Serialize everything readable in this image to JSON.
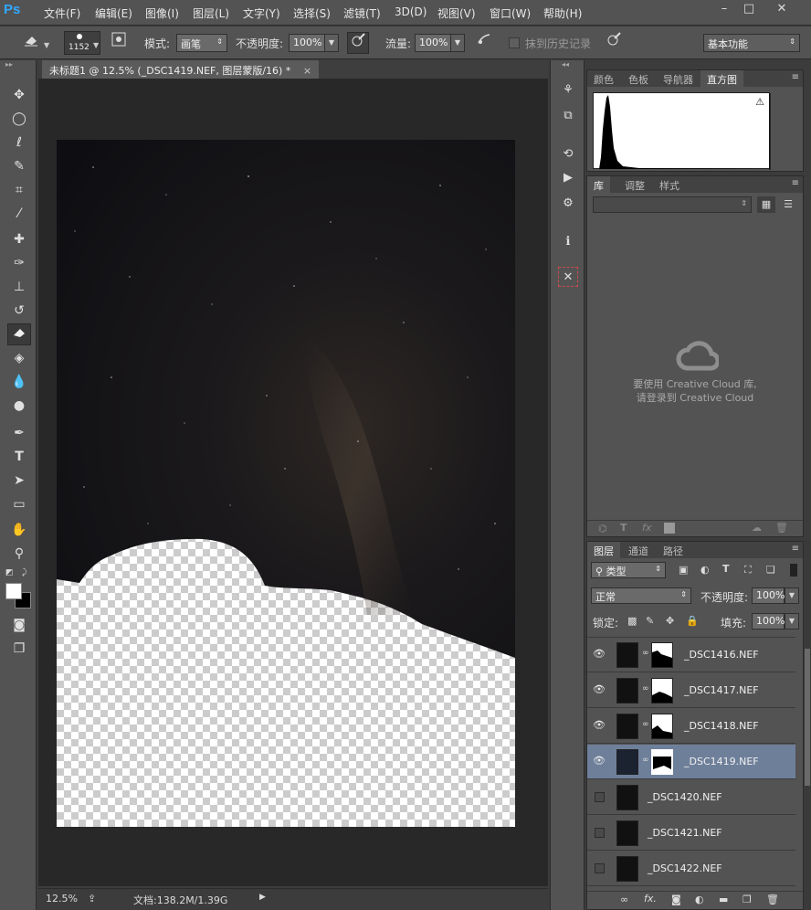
{
  "app": {
    "logo": "Ps"
  },
  "menu": [
    "文件(F)",
    "编辑(E)",
    "图像(I)",
    "图层(L)",
    "文字(Y)",
    "选择(S)",
    "滤镜(T)",
    "3D(D)",
    "视图(V)",
    "窗口(W)",
    "帮助(H)"
  ],
  "window_controls": {
    "minimize": "–",
    "maximize": "□",
    "close": "✕"
  },
  "options_bar": {
    "brush_size": "1152",
    "mode_label": "模式:",
    "mode_value": "画笔",
    "opacity_label": "不透明度:",
    "opacity_value": "100%",
    "flow_label": "流量:",
    "flow_value": "100%",
    "history_label": "抹到历史记录",
    "workspace": "基本功能"
  },
  "document": {
    "tab_title": "未标题1 @ 12.5% (_DSC1419.NEF, 图层蒙版/16) *",
    "tab_close": "×"
  },
  "status": {
    "zoom": "12.5%",
    "doc_info": "文档:138.2M/1.39G"
  },
  "panels": {
    "top_tabs": [
      "颜色",
      "色板",
      "导航器",
      "直方图"
    ],
    "top_active": 3,
    "mid_tabs": [
      "库",
      "调整",
      "样式"
    ],
    "mid_active": 0,
    "cc_message": [
      "要使用 Creative Cloud 库,",
      "请登录到 Creative Cloud"
    ],
    "layers_tabs": [
      "图层",
      "通道",
      "路径"
    ],
    "layers_active": 0
  },
  "layers": {
    "filter_type": "类型",
    "blend_mode": "正常",
    "opacity_label": "不透明度:",
    "opacity_value": "100%",
    "lock_label": "锁定:",
    "fill_label": "填充:",
    "fill_value": "100%",
    "items": [
      {
        "name": "_DSC1416.NEF",
        "visible": true,
        "has_mask": true,
        "selected": false
      },
      {
        "name": "_DSC1417.NEF",
        "visible": true,
        "has_mask": true,
        "selected": false
      },
      {
        "name": "_DSC1418.NEF",
        "visible": true,
        "has_mask": true,
        "selected": false
      },
      {
        "name": "_DSC1419.NEF",
        "visible": true,
        "has_mask": true,
        "selected": true
      },
      {
        "name": "_DSC1420.NEF",
        "visible": false,
        "has_mask": false,
        "selected": false
      },
      {
        "name": "_DSC1421.NEF",
        "visible": false,
        "has_mask": false,
        "selected": false
      },
      {
        "name": "_DSC1422.NEF",
        "visible": false,
        "has_mask": false,
        "selected": false
      }
    ]
  },
  "colors": {
    "ui": "#535353",
    "canvas_bg": "#282828",
    "selection": "#6e7f9a",
    "ps_blue": "#31a8ff"
  }
}
